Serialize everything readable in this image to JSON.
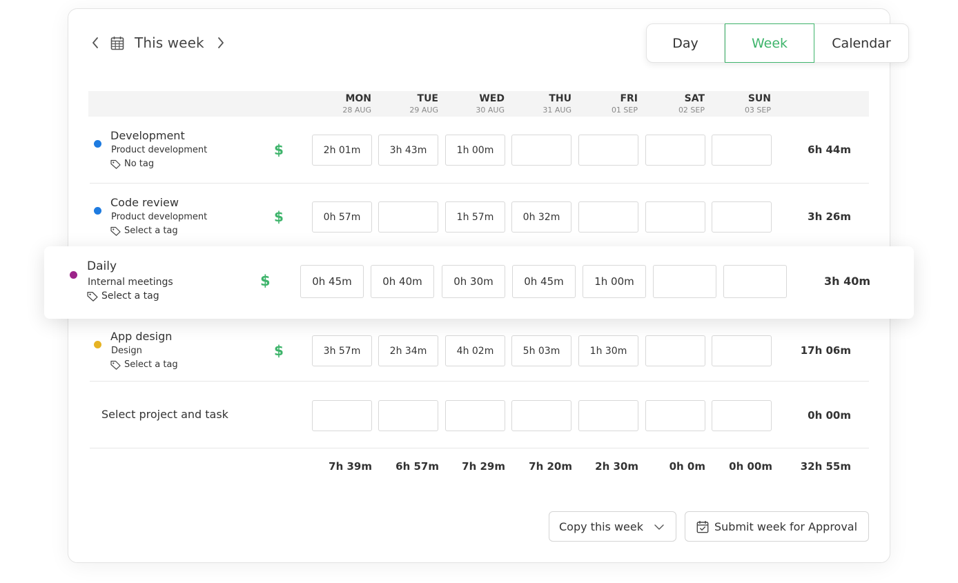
{
  "header": {
    "period_title": "This week",
    "views": [
      "Day",
      "Week",
      "Calendar"
    ],
    "active_view": "Week"
  },
  "days": [
    {
      "name": "MON",
      "date": "28 AUG"
    },
    {
      "name": "TUE",
      "date": "29 AUG"
    },
    {
      "name": "WED",
      "date": "30 AUG"
    },
    {
      "name": "THU",
      "date": "31 AUG"
    },
    {
      "name": "FRI",
      "date": "01 SEP"
    },
    {
      "name": "SAT",
      "date": "02 SEP"
    },
    {
      "name": "SUN",
      "date": "03 SEP"
    }
  ],
  "rows": [
    {
      "name": "Development",
      "project": "Product development",
      "tag": "No tag",
      "color": "#1e7be0",
      "cells": [
        "2h 01m",
        "3h 43m",
        "1h 00m",
        "",
        "",
        "",
        ""
      ],
      "total": "6h 44m",
      "billable_symbol": "$"
    },
    {
      "name": "Code review",
      "project": "Product development",
      "tag": "Select a tag",
      "color": "#1e7be0",
      "cells": [
        "0h 57m",
        "",
        "1h 57m",
        "0h 32m",
        "",
        "",
        ""
      ],
      "total": "3h 26m",
      "billable_symbol": "$"
    },
    {
      "name": "Daily",
      "project": "Internal meetings",
      "tag": "Select a tag",
      "color": "#9c2489",
      "cells": [
        "0h 45m",
        "0h 40m",
        "0h 30m",
        "0h 45m",
        "1h 00m",
        "",
        ""
      ],
      "total": "3h 40m",
      "billable_symbol": "$"
    },
    {
      "name": "App design",
      "project": "Design",
      "tag": "Select a tag",
      "color": "#e6b324",
      "cells": [
        "3h 57m",
        "2h 34m",
        "4h 02m",
        "5h 03m",
        "1h 30m",
        "",
        ""
      ],
      "total": "17h 06m",
      "billable_symbol": "$"
    }
  ],
  "new_row": {
    "label": "Select project and task",
    "cells": [
      "",
      "",
      "",
      "",
      "",
      "",
      ""
    ],
    "total": "0h 00m"
  },
  "day_totals": [
    "7h 39m",
    "6h 57m",
    "7h 29m",
    "7h 20m",
    "2h 30m",
    "0h 0m",
    "0h 00m"
  ],
  "grand_total": "32h 55m",
  "footer": {
    "copy_label": "Copy this week",
    "submit_label": "Submit week for Approval"
  },
  "colors": {
    "accent_green": "#3eb46b"
  }
}
